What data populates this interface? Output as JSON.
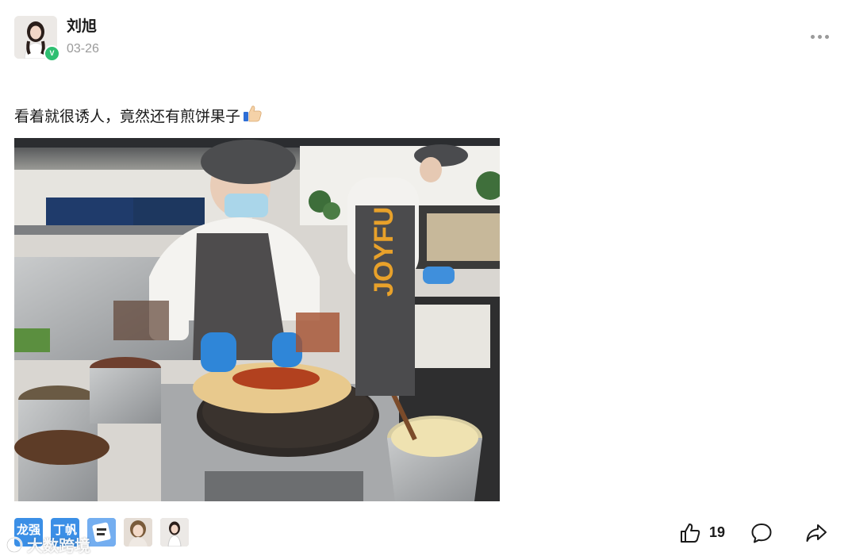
{
  "post": {
    "author": "刘旭",
    "date": "03-26",
    "verified_badge": "V",
    "text": "看着就很诱人，竟然还有煎饼果子",
    "emoji": "thumbs-up-emoji",
    "photo_text": "JOYFU"
  },
  "likers": [
    {
      "name": "龙强",
      "kind": "text-avatar"
    },
    {
      "name": "丁帆",
      "kind": "text-avatar"
    },
    {
      "name": "",
      "kind": "icon-avatar"
    },
    {
      "name": "",
      "kind": "photo-avatar"
    },
    {
      "name": "",
      "kind": "photo-avatar"
    }
  ],
  "actions": {
    "like_count": "19"
  },
  "watermark": {
    "text": "大数跨境"
  },
  "colors": {
    "accent_blue": "#3b8fe6",
    "verified_green": "#2fbf71",
    "muted_text": "#9a9a9a"
  }
}
